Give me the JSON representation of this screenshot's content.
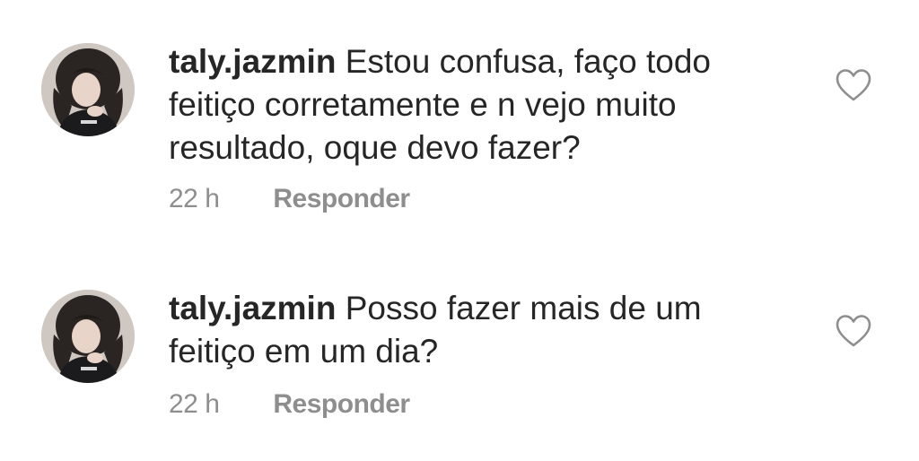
{
  "comments": [
    {
      "username": "taly.jazmin",
      "text": "Estou confusa, faço todo feitiço corretamente e n vejo muito resultado, oque devo fazer?",
      "timestamp": "22 h",
      "reply_label": "Responder",
      "avatar_icon": "profile-photo",
      "like_icon": "heart-outline-icon"
    },
    {
      "username": "taly.jazmin",
      "text": "Posso fazer mais de um feitiço em um dia?",
      "timestamp": "22 h",
      "reply_label": "Responder",
      "avatar_icon": "profile-photo",
      "like_icon": "heart-outline-icon"
    }
  ],
  "colors": {
    "text_primary": "#262626",
    "text_secondary": "#8e8e8e",
    "icon_stroke": "#8e8e8e",
    "background": "#ffffff"
  }
}
